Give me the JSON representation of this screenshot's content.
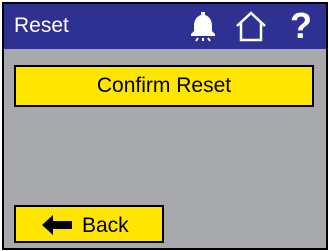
{
  "header": {
    "title": "Reset",
    "icons": [
      "bell-icon",
      "home-icon",
      "help-icon"
    ],
    "help_glyph": "?",
    "background_color": "#2e3192"
  },
  "main": {
    "confirm_label": "Confirm Reset",
    "background_color": "#a7a9ac",
    "button_color": "#ffe600"
  },
  "footer": {
    "back_label": "Back",
    "back_icon": "left-arrow-icon"
  }
}
